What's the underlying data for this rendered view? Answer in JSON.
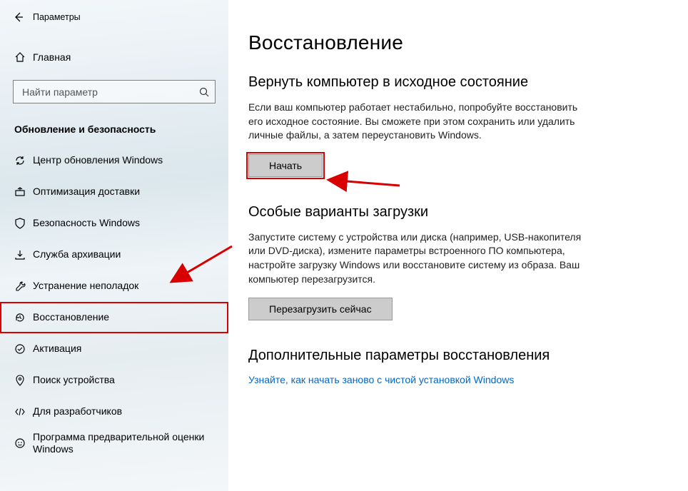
{
  "window": {
    "title": "Параметры"
  },
  "home": {
    "label": "Главная"
  },
  "search": {
    "placeholder": "Найти параметр"
  },
  "group": {
    "title": "Обновление и безопасность"
  },
  "sidebar": {
    "items": [
      {
        "icon": "sync",
        "label": "Центр обновления Windows"
      },
      {
        "icon": "delivery",
        "label": "Оптимизация доставки"
      },
      {
        "icon": "shield",
        "label": "Безопасность Windows"
      },
      {
        "icon": "backup",
        "label": "Служба архивации"
      },
      {
        "icon": "troubleshoot",
        "label": "Устранение неполадок"
      },
      {
        "icon": "recovery",
        "label": "Восстановление",
        "highlight": true
      },
      {
        "icon": "activation",
        "label": "Активация"
      },
      {
        "icon": "find",
        "label": "Поиск устройства"
      },
      {
        "icon": "developer",
        "label": "Для разработчиков"
      },
      {
        "icon": "insider",
        "label": "Программа предварительной оценки Windows"
      }
    ]
  },
  "page": {
    "title": "Восстановление"
  },
  "reset": {
    "title": "Вернуть компьютер в исходное состояние",
    "body": "Если ваш компьютер работает нестабильно, попробуйте восстановить его исходное состояние. Вы сможете при этом сохранить или удалить личные файлы, а затем переустановить Windows.",
    "button": "Начать"
  },
  "advanced": {
    "title": "Особые варианты загрузки",
    "body": "Запустите систему с устройства или диска (например, USB-накопителя или DVD-диска), измените параметры встроенного ПО компьютера, настройте загрузку Windows или восстановите систему из образа. Ваш компьютер перезагрузится.",
    "button": "Перезагрузить сейчас"
  },
  "more": {
    "title": "Дополнительные параметры восстановления",
    "link": "Узнайте, как начать заново с чистой установкой Windows"
  }
}
